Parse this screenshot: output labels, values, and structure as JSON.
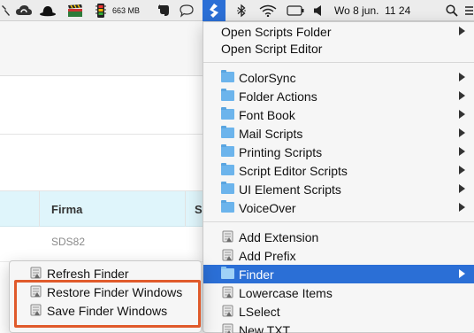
{
  "menubar": {
    "icons": [
      "wrench-icon",
      "cloud-sync-icon",
      "bowler-hat-icon",
      "clapperboard-icon",
      "memory-chip-icon",
      "elephant-icon",
      "speech-bubble-icon",
      "scripts-icon",
      "bluetooth-icon",
      "wifi-icon",
      "volume-icon",
      "search-icon"
    ],
    "memory_label": "663 MB",
    "datetime": "Wo 8 jun.  11 24"
  },
  "background_app": {
    "column_header_firma": "Firma",
    "column_header_s": "S",
    "cell_sds": "SDS82"
  },
  "scripts_menu": {
    "top_items": [
      {
        "label": "Open Scripts Folder",
        "has_submenu": true
      },
      {
        "label": "Open Script Editor",
        "has_submenu": false
      }
    ],
    "folders": [
      {
        "label": "ColorSync",
        "has_submenu": true
      },
      {
        "label": "Folder Actions",
        "has_submenu": true
      },
      {
        "label": "Font Book",
        "has_submenu": true
      },
      {
        "label": "Mail Scripts",
        "has_submenu": true
      },
      {
        "label": "Printing Scripts",
        "has_submenu": true
      },
      {
        "label": "Script Editor Scripts",
        "has_submenu": true
      },
      {
        "label": "UI Element Scripts",
        "has_submenu": true
      },
      {
        "label": "VoiceOver",
        "has_submenu": true
      }
    ],
    "user_items": [
      {
        "label": "Add Extension",
        "type": "script"
      },
      {
        "label": "Add Prefix",
        "type": "script"
      },
      {
        "label": "Finder",
        "type": "folder",
        "has_submenu": true,
        "highlighted": true
      },
      {
        "label": "Lowercase Items",
        "type": "script"
      },
      {
        "label": "LSelect",
        "type": "script"
      },
      {
        "label": "New TXT",
        "type": "script"
      }
    ]
  },
  "finder_submenu": {
    "items": [
      {
        "label": "Refresh Finder"
      },
      {
        "label": "Restore Finder Windows"
      },
      {
        "label": "Save Finder Windows"
      }
    ]
  },
  "colors": {
    "highlight": "#2b6fd6",
    "folder": "#6cb4ec",
    "annotation_box": "#e05a2b",
    "table_header_bg": "#dff5fb"
  }
}
